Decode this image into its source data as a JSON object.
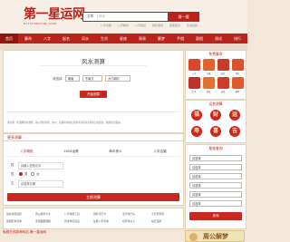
{
  "brand": {
    "logo_cn": "第一星运网",
    "logo_en": "DIYIXINGYUN.COM"
  },
  "search": {
    "category": "文章",
    "placeholder": "风水",
    "button": "搜一搜"
  },
  "hot_words": [
    "八字合婚",
    "八字精批",
    "八字起名",
    "姓名测试",
    "星座配对",
    "生肖运势"
  ],
  "nav": {
    "items": [
      "首页",
      "算命",
      "八字",
      "起名",
      "风水",
      "生肖",
      "星座",
      "周易",
      "解梦",
      "手相",
      "面相",
      "测试",
      "排行"
    ]
  },
  "main": {
    "title": "风水测算",
    "form_label": "请选择",
    "select_1": "朝南",
    "select_2": "东南方",
    "select_3": "大门朝向",
    "submit": "开始测算",
    "desc": "通过第一星运网风水测算，输入您的住宅、办公、店铺等朝向信息即可获得专业风水分析建议，助您趋吉避凶。"
  },
  "more": {
    "heading": "更多测算",
    "tabs": [
      "八字精批",
      "2024运势",
      "命中贵人",
      "八字合婚"
    ],
    "name_label": "姓",
    "name_value": "请输入您的名字",
    "gender_label": "性",
    "gender_options": [
      "男",
      "女"
    ],
    "birth_label": "生",
    "birth_value": "请选择日期",
    "submit": "立即测算"
  },
  "links": [
    [
      "最新星座运势",
      "周公解梦大全",
      "八字排盘工具",
      "测名字打分",
      "五行缺什么",
      "今日老黄历"
    ],
    [
      "属相配对查询",
      "手相面相图解",
      "风水布局禁忌",
      "生辰八字查询",
      "塔罗牌占卜",
      "每日运势"
    ]
  ],
  "footer_title": "免费在线算命网站-第一星运网",
  "sidebar": {
    "free_title": "免费算命",
    "free_items": [
      "八字",
      "合婚",
      "起名",
      "测名",
      "生肖",
      "星座",
      "运势",
      "解梦"
    ],
    "tools_title": "运势测算",
    "circles": [
      "福",
      "财",
      "运",
      "寿",
      "喜",
      "吉"
    ],
    "query_title": "星座查询",
    "query_rows": [
      "请选择",
      "请选择",
      "请选择",
      "请选择",
      "请选择",
      "请选择"
    ],
    "query_button": "查询",
    "banner": "周公解梦"
  }
}
